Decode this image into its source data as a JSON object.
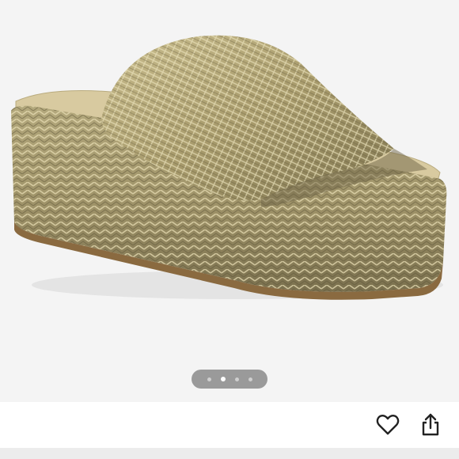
{
  "product_image": {
    "alt": "",
    "description_icon": "gold-woven-platform-slide-sandal"
  },
  "carousel": {
    "total": 4,
    "active_index": 1
  },
  "actions": {
    "like_icon": "heart-outline-icon",
    "share_icon": "share-icon"
  },
  "colors": {
    "gallery_bg": "#f4f4f4",
    "dots_pill": "#9a9a9a",
    "dot_active": "#ffffff",
    "icon": "#222222"
  }
}
